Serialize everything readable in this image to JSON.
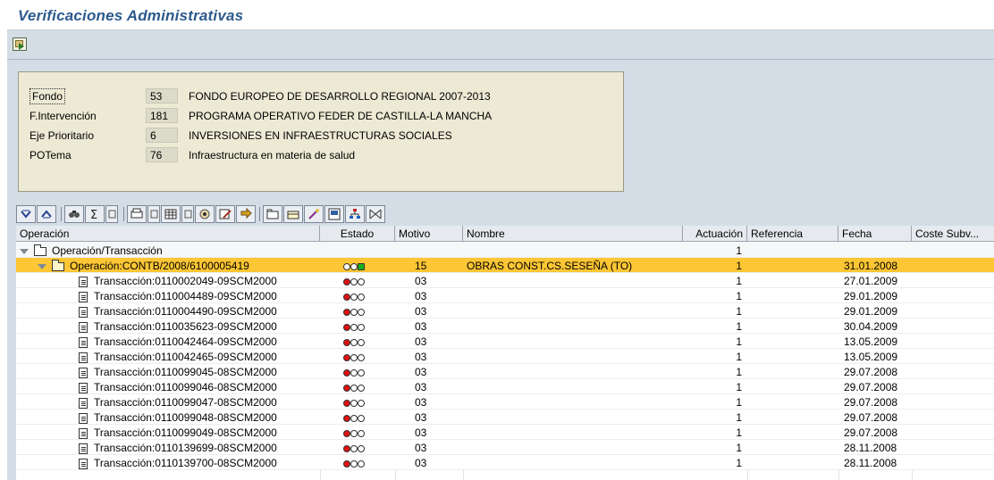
{
  "title": "Verificaciones Administrativas",
  "info": [
    {
      "label": "Fondo",
      "num": "53",
      "text": "FONDO EUROPEO DE DESARROLLO REGIONAL  2007-2013"
    },
    {
      "label": "F.Intervención",
      "num": "181",
      "text": "PROGRAMA OPERATIVO FEDER DE CASTILLA-LA MANCHA"
    },
    {
      "label": "Eje Prioritario",
      "num": "6",
      "text": "INVERSIONES EN INFRAESTRUCTURAS SOCIALES"
    },
    {
      "label": "POTema",
      "num": "76",
      "text": "Infraestructura en materia de salud"
    }
  ],
  "columns": {
    "operacion": "Operación",
    "estado": "Estado",
    "motivo": "Motivo",
    "nombre": "Nombre",
    "actuacion": "Actuación",
    "referencia": "Referencia",
    "fecha": "Fecha",
    "coste": "Coste Subv..."
  },
  "root_row": {
    "label": "Operación/Transacción",
    "actuacion": "1"
  },
  "operation_row": {
    "label": "Operación:CONTB/2008/6100005419",
    "estado": "yellow-green",
    "motivo": "15",
    "nombre": "OBRAS CONST.CS.SESEÑA (TO)",
    "actuacion": "1",
    "fecha": "31.01.2008"
  },
  "rows": [
    {
      "label": "Transacción:0110002049-09SCM2000",
      "motivo": "03",
      "actuacion": "1",
      "fecha": "27.01.2009"
    },
    {
      "label": "Transacción:0110004489-09SCM2000",
      "motivo": "03",
      "actuacion": "1",
      "fecha": "29.01.2009"
    },
    {
      "label": "Transacción:0110004490-09SCM2000",
      "motivo": "03",
      "actuacion": "1",
      "fecha": "29.01.2009"
    },
    {
      "label": "Transacción:0110035623-09SCM2000",
      "motivo": "03",
      "actuacion": "1",
      "fecha": "30.04.2009"
    },
    {
      "label": "Transacción:0110042464-09SCM2000",
      "motivo": "03",
      "actuacion": "1",
      "fecha": "13.05.2009"
    },
    {
      "label": "Transacción:0110042465-09SCM2000",
      "motivo": "03",
      "actuacion": "1",
      "fecha": "13.05.2009"
    },
    {
      "label": "Transacción:0110099045-08SCM2000",
      "motivo": "03",
      "actuacion": "1",
      "fecha": "29.07.2008"
    },
    {
      "label": "Transacción:0110099046-08SCM2000",
      "motivo": "03",
      "actuacion": "1",
      "fecha": "29.07.2008"
    },
    {
      "label": "Transacción:0110099047-08SCM2000",
      "motivo": "03",
      "actuacion": "1",
      "fecha": "29.07.2008"
    },
    {
      "label": "Transacción:0110099048-08SCM2000",
      "motivo": "03",
      "actuacion": "1",
      "fecha": "29.07.2008"
    },
    {
      "label": "Transacción:0110099049-08SCM2000",
      "motivo": "03",
      "actuacion": "1",
      "fecha": "29.07.2008"
    },
    {
      "label": "Transacción:0110139699-08SCM2000",
      "motivo": "03",
      "actuacion": "1",
      "fecha": "28.11.2008"
    },
    {
      "label": "Transacción:0110139700-08SCM2000",
      "motivo": "03",
      "actuacion": "1",
      "fecha": "28.11.2008"
    }
  ],
  "colors": {
    "selected": "#fcc634",
    "red": "#e01010",
    "green": "#19b21e",
    "title": "#2c5a8c"
  }
}
